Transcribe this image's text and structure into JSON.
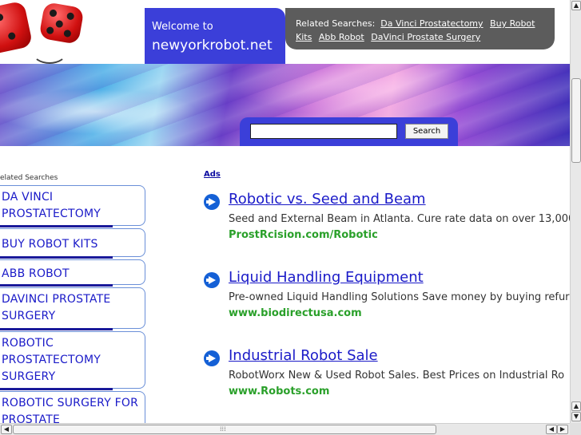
{
  "header": {
    "welcome_text": "Welcome to",
    "domain": "newyorkrobot.net",
    "related_label": "Related Searches:",
    "related_links": [
      "Da Vinci Prostatectomy",
      "Buy Robot Kits",
      "Abb Robot",
      "DaVinci Prostate Surgery"
    ]
  },
  "search": {
    "input_value": "",
    "button_label": "Search"
  },
  "sidebar": {
    "title": "elated Searches",
    "items": [
      "DA VINCI PROSTATECTOMY",
      "BUY ROBOT KITS",
      "ABB ROBOT",
      "DAVINCI PROSTATE SURGERY",
      "ROBOTIC PROSTATECTOMY SURGERY",
      "ROBOTIC SURGERY FOR PROSTATE"
    ]
  },
  "ads": {
    "label": "Ads",
    "items": [
      {
        "title": "Robotic vs. Seed and Beam",
        "desc": "Seed and External Beam in Atlanta. Cure rate data on over 13,000",
        "url": "ProstRcision.com/Robotic"
      },
      {
        "title": "Liquid Handling Equipment",
        "desc": "Pre-owned Liquid Handling Solutions Save money by buying refur",
        "url": "www.biodirectusa.com"
      },
      {
        "title": "Industrial Robot Sale",
        "desc": "RobotWorx New & Used Robot Sales. Best Prices on Industrial Ro",
        "url": "www.Robots.com"
      }
    ]
  },
  "icons": {
    "ad_arrow": "circle-arrow-right-icon",
    "scroll_up": "▲",
    "scroll_down": "▼",
    "scroll_left": "◀",
    "scroll_right": "▶",
    "grip": "⁞⁞⁞"
  },
  "colors": {
    "link": "#1a1ac8",
    "ad_url": "#2aa02a",
    "header_blue": "#3b3fd9",
    "related_bar": "#5c5c5c"
  }
}
